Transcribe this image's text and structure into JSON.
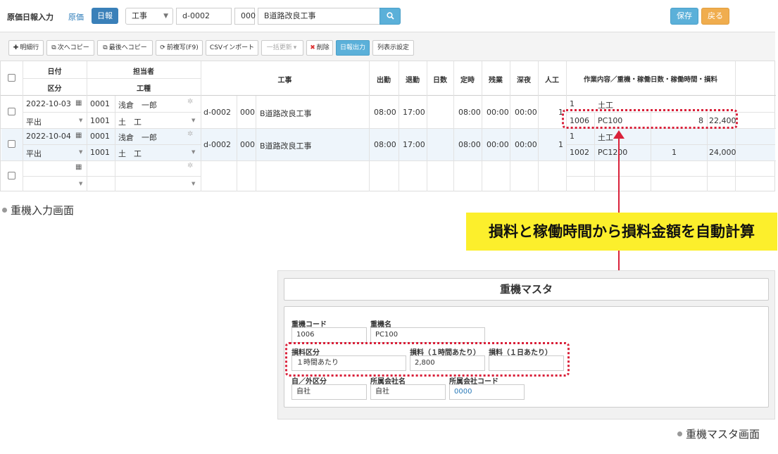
{
  "header": {
    "title": "原価日報入力",
    "mode_cost": "原価",
    "mode_daily": "日報",
    "category_select": "工事",
    "code_input": "d-0002",
    "branch_input": "000",
    "name_input": "B道路改良工事",
    "save_label": "保存",
    "back_label": "戻る"
  },
  "toolbar": {
    "add_row": "明細行",
    "copy_next": "次へコピー",
    "copy_last": "最後へコピー",
    "copy_prev": "前複写(F9)",
    "csv_import": "CSVインポート",
    "bulk_update": "一括更新",
    "delete": "削除",
    "daily_output": "日報出力",
    "column_settings": "列表示設定"
  },
  "grid": {
    "headers": {
      "date": "日付",
      "category": "区分",
      "person": "担当者",
      "trade": "工種",
      "work": "工事",
      "start": "出勤",
      "leave": "退勤",
      "days": "日数",
      "regular": "定時",
      "overtime": "残業",
      "night": "深夜",
      "labor": "人工",
      "detail": "作業内容／重機・稼働日数・稼働時間・損料"
    },
    "rows": [
      {
        "date": "2022-10-03",
        "category": "平出",
        "person_code": "0001",
        "person_name": "浅倉　一郎",
        "trade_code": "1001",
        "trade_name": "土　工",
        "work_code": "d-0002",
        "work_branch": "000",
        "work_name": "B道路改良工事",
        "start": "08:00",
        "leave": "17:00",
        "regular": "08:00",
        "overtime": "00:00",
        "night": "00:00",
        "labor": "1",
        "d1_code": "1",
        "d1_name": "土工",
        "d2_code": "1006",
        "d2_name": "PC100",
        "d2_days": "",
        "d2_hours": "8",
        "d2_amount": "22,400"
      },
      {
        "date": "2022-10-04",
        "category": "平出",
        "person_code": "0001",
        "person_name": "浅倉　一郎",
        "trade_code": "1001",
        "trade_name": "土　工",
        "work_code": "d-0002",
        "work_branch": "000",
        "work_name": "B道路改良工事",
        "start": "08:00",
        "leave": "17:00",
        "regular": "08:00",
        "overtime": "00:00",
        "night": "00:00",
        "labor": "1",
        "d1_code": "1",
        "d1_name": "土工",
        "d2_code": "1002",
        "d2_name": "PC1200",
        "d2_days": "1",
        "d2_hours": "",
        "d2_amount": "24,000"
      }
    ]
  },
  "captions": {
    "entry_screen": "重機入力画面",
    "master_screen": "重機マスタ画面",
    "callout": "損料と稼働時間から損料金額を自動計算"
  },
  "master": {
    "title": "重機マスタ",
    "fields": {
      "code_label": "重機コード",
      "code_value": "1006",
      "name_label": "重機名",
      "name_value": "PC100",
      "rate_type_label": "損料区分",
      "rate_type_value": "１時間あたり",
      "hourly_label": "損料（１時間あたり）",
      "hourly_value": "2,800",
      "daily_label": "損料（１日あたり）",
      "daily_value": "",
      "ownership_label": "自／外区分",
      "ownership_value": "自社",
      "company_label": "所属会社名",
      "company_value": "自社",
      "company_code_label": "所属会社コード",
      "company_code_value": "0000"
    }
  },
  "colors": {
    "primary": "#3a80b9",
    "info": "#5bb0d9",
    "warning": "#f0ad4e",
    "highlight": "#d9213a",
    "callout_bg": "#fcef2c"
  }
}
